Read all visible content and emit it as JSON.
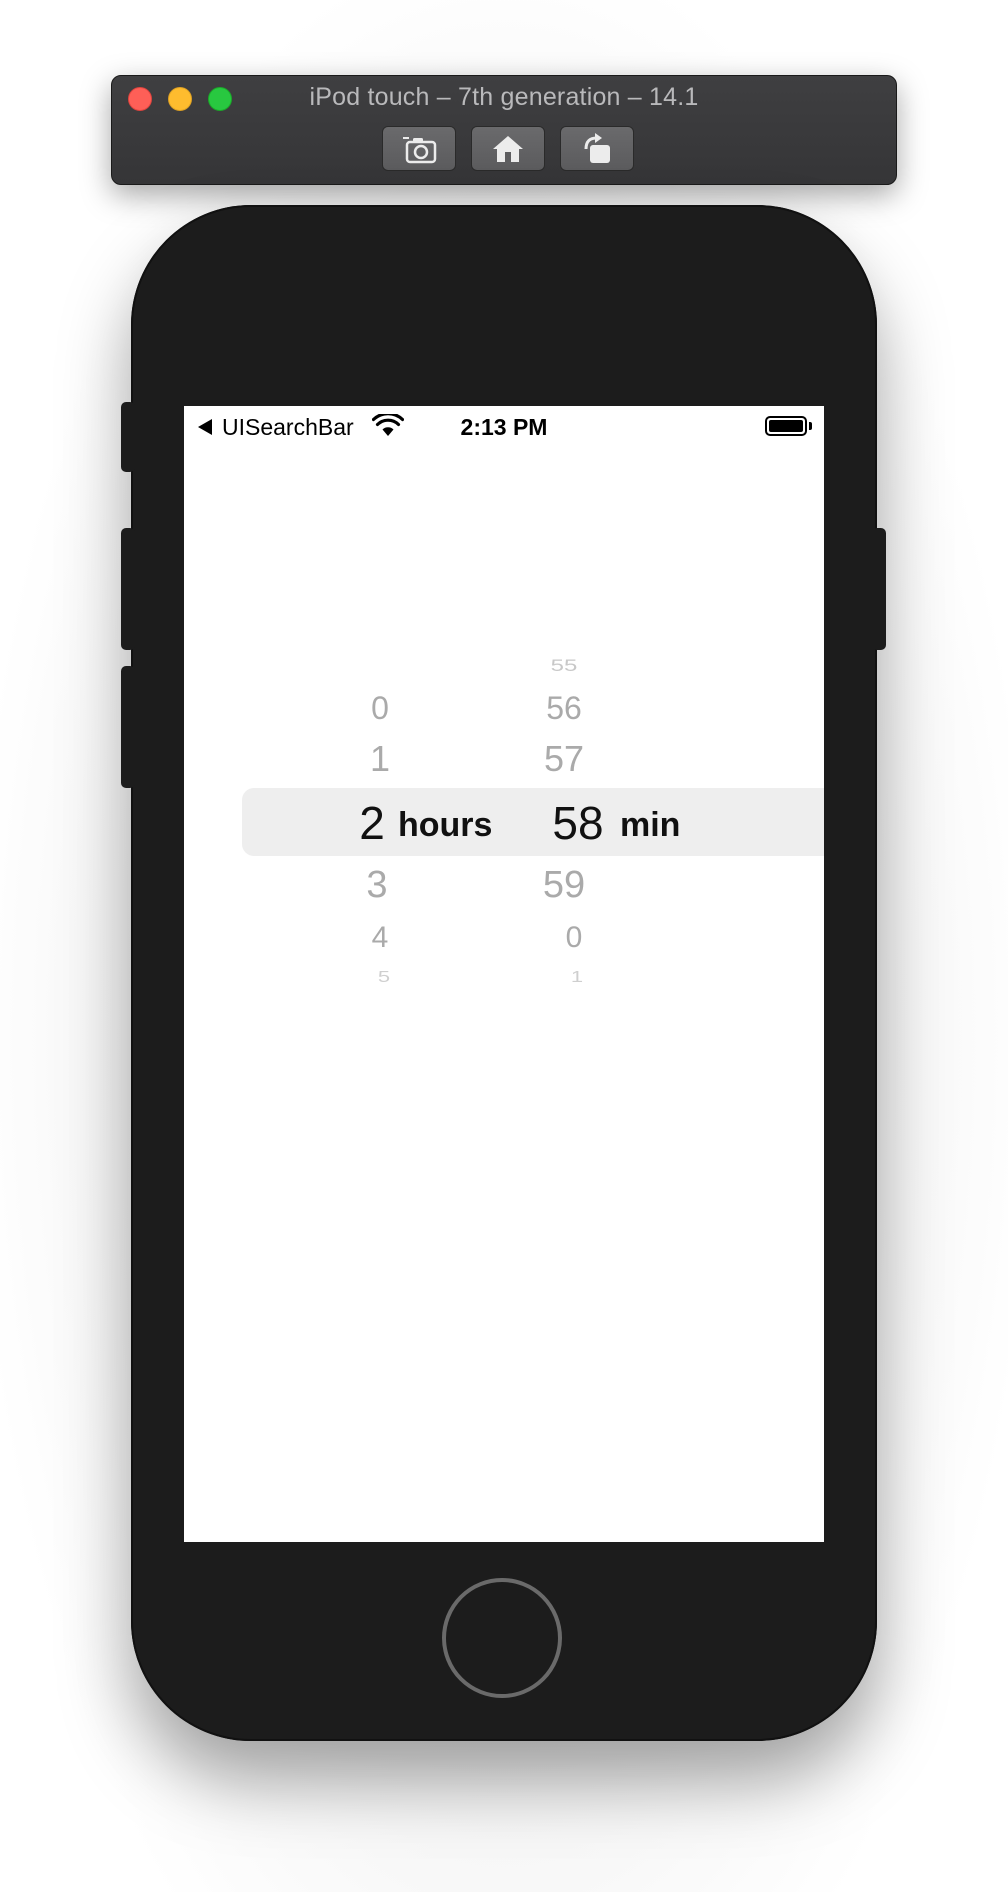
{
  "simulator": {
    "title": "iPod touch – 7th generation – 14.1",
    "buttons": [
      {
        "name": "screenshot",
        "icon": "camera-icon"
      },
      {
        "name": "home",
        "icon": "home-icon"
      },
      {
        "name": "rotate",
        "icon": "rotate-icon"
      }
    ]
  },
  "status_bar": {
    "back_label": "UISearchBar",
    "time": "2:13 PM",
    "wifi_icon": "wifi-icon",
    "battery_icon": "battery-icon",
    "battery_level": 1.0
  },
  "picker": {
    "hours": {
      "unit_label": "hours",
      "above": [
        "0",
        "1"
      ],
      "selected": "2",
      "below": [
        "3",
        "4",
        "5"
      ]
    },
    "minutes": {
      "unit_label": "min",
      "above": [
        "55",
        "56",
        "57"
      ],
      "selected": "58",
      "below": [
        "59",
        "0",
        "1"
      ]
    }
  },
  "colors": {
    "device_body": "#1c1c1c",
    "selection_band": "#eeeeee",
    "unselected_text": "#aaaaaa",
    "selected_text": "#111111"
  }
}
